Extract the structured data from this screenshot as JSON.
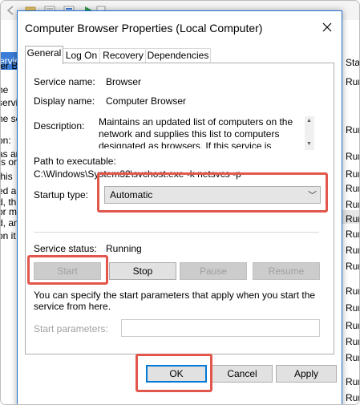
{
  "background": {
    "left_header": "ervice",
    "left_lines": [
      "ter B",
      "he",
      "servi",
      "he se",
      "on:",
      "as and",
      "rs or",
      "this",
      "ed an",
      "d, th",
      "or m",
      "d, an",
      "on it"
    ],
    "right_header": "Stat",
    "right_lines": [
      "Run",
      "Run",
      "Run",
      "Run",
      "Run",
      "Run",
      "Run",
      "Run",
      "Run",
      "Run",
      "Run",
      "Run",
      "Run",
      "Run",
      "Run",
      "Run",
      "Run"
    ]
  },
  "dialog": {
    "title": "Computer Browser Properties (Local Computer)",
    "tabs": [
      {
        "label": "General",
        "active": true
      },
      {
        "label": "Log On"
      },
      {
        "label": "Recovery"
      },
      {
        "label": "Dependencies"
      }
    ],
    "service_name_label": "Service name:",
    "service_name": "Browser",
    "display_name_label": "Display name:",
    "display_name": "Computer Browser",
    "description_label": "Description:",
    "description": "Maintains an updated list of computers on the network and supplies this list to computers designated as browsers. If this service is stopped,",
    "path_label": "Path to executable:",
    "path": "C:\\Windows\\System32\\svchost.exe -k netsvcs -p",
    "startup_type_label": "Startup type:",
    "startup_type": "Automatic",
    "service_status_label": "Service status:",
    "service_status": "Running",
    "buttons": {
      "start": "Start",
      "stop": "Stop",
      "pause": "Pause",
      "resume": "Resume"
    },
    "hint": "You can specify the start parameters that apply when you start the service from here.",
    "start_params_label": "Start parameters:",
    "start_params_value": "",
    "footer": {
      "ok": "OK",
      "cancel": "Cancel",
      "apply": "Apply"
    }
  },
  "colors": {
    "highlight": "#e2574c",
    "accent": "#0078d7"
  }
}
